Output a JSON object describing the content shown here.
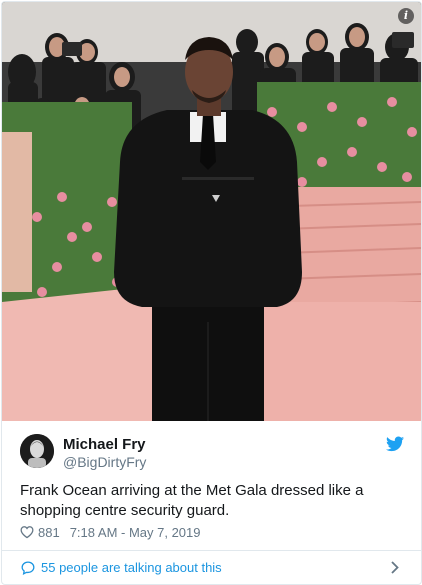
{
  "tweet": {
    "author_name": "Michael Fry",
    "author_handle": "@BigDirtyFry",
    "text": "Frank Ocean arriving at the Met Gala dressed like a shopping centre security guard.",
    "like_count": "881",
    "timestamp": "7:18 AM - May 7, 2019",
    "conversation_label": "55 people are talking about this"
  },
  "icons": {
    "info": "info-icon",
    "avatar": "avatar",
    "platform": "twitter-bird-icon",
    "like": "heart-icon",
    "reply": "speech-bubble-icon",
    "more": "chevron-right-icon"
  },
  "colors": {
    "accent": "#1da1f2",
    "link": "#1b95e0",
    "text": "#14171a",
    "secondary": "#657786",
    "border": "#e1e8ed",
    "carpet": "#e9a9a1"
  }
}
